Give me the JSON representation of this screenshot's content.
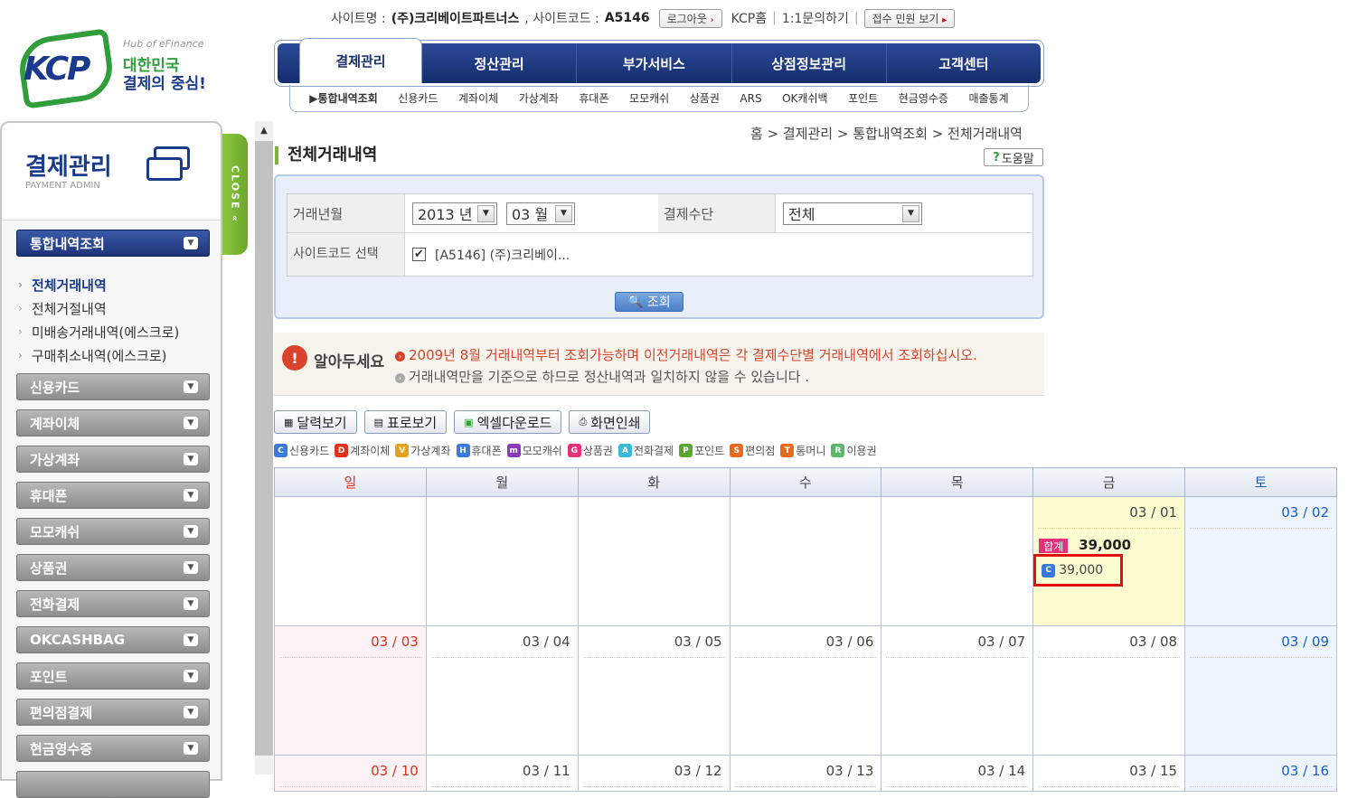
{
  "topbar": {
    "site_label": "사이트명 :",
    "site_name": "(주)크리베이트파트너스",
    "code_label": ", 사이트코드 :",
    "site_code": "A5146",
    "logout": "로그아웃",
    "kcp_home": "KCP홈",
    "inquiry": "1:1문의하기",
    "complaint": "접수 민원 보기"
  },
  "logo": {
    "brand": "KCP",
    "hub": "Hub of eFinance",
    "slogan1": "대한민국",
    "slogan2": "결제의 중심!"
  },
  "main_nav": [
    "결제관리",
    "정산관리",
    "부가서비스",
    "상점정보관리",
    "고객센터"
  ],
  "sub_nav": [
    "통합내역조회",
    "신용카드",
    "계좌이체",
    "가상계좌",
    "휴대폰",
    "모모캐쉬",
    "상품권",
    "ARS",
    "OK캐쉬백",
    "포인트",
    "현금영수증",
    "매출통계"
  ],
  "sidebar": {
    "title": "결제관리",
    "subtitle": "PAYMENT ADMIN",
    "close": "CLOSE",
    "active_menu": "통합내역조회",
    "sub_items": [
      "전체거래내역",
      "전체거절내역",
      "미배송거래내역(에스크로)",
      "구매취소내역(에스크로)"
    ],
    "menus": [
      "신용카드",
      "계좌이체",
      "가상계좌",
      "휴대폰",
      "모모캐쉬",
      "상품권",
      "전화결제",
      "OKCASHBAG",
      "포인트",
      "편의점결제",
      "현금영수증"
    ]
  },
  "breadcrumb": "홈 > 결제관리 > 통합내역조회 > 전체거래내역",
  "page_title": "전체거래내역",
  "help": "도움말",
  "search": {
    "month_label": "거래년월",
    "year": "2013 년",
    "month": "03 월",
    "method_label": "결제수단",
    "method": "전체",
    "site_label": "사이트코드 선택",
    "site_value": "[A5146] (주)크리베이...",
    "button": "조회"
  },
  "notice": {
    "label": "알아두세요",
    "line1": "2009년 8월 거래내역부터 조회가능하며 이전거래내역은 각 결제수단별 거래내역에서 조회하십시오.",
    "line2": "거래내역만을 기준으로 하므로 정산내역과 일치하지 않을 수 있습니다 ."
  },
  "actions": [
    "달력보기",
    "표로보기",
    "엑셀다운로드",
    "화면인쇄"
  ],
  "legend": [
    {
      "code": "C",
      "label": "신용카드",
      "color": "#3a7ad8"
    },
    {
      "code": "D",
      "label": "계좌이체",
      "color": "#e0301e"
    },
    {
      "code": "V",
      "label": "가상계좌",
      "color": "#e8a020"
    },
    {
      "code": "H",
      "label": "휴대폰",
      "color": "#3a7ad8"
    },
    {
      "code": "m",
      "label": "모모캐쉬",
      "color": "#8a3ab8"
    },
    {
      "code": "G",
      "label": "상품권",
      "color": "#e8307a"
    },
    {
      "code": "A",
      "label": "전화결제",
      "color": "#3ab8d8"
    },
    {
      "code": "P",
      "label": "포인트",
      "color": "#5aa830"
    },
    {
      "code": "S",
      "label": "편의점",
      "color": "#e86a20"
    },
    {
      "code": "T",
      "label": "통머니",
      "color": "#e86a20"
    },
    {
      "code": "R",
      "label": "이용권",
      "color": "#5ab868"
    }
  ],
  "calendar": {
    "weekdays": [
      "일",
      "월",
      "화",
      "수",
      "목",
      "금",
      "토"
    ],
    "weeks": [
      [
        "",
        "",
        "",
        "",
        "",
        "03 / 01",
        "03 / 02"
      ],
      [
        "03 / 03",
        "03 / 04",
        "03 / 05",
        "03 / 06",
        "03 / 07",
        "03 / 08",
        "03 / 09"
      ],
      [
        "03 / 10",
        "03 / 11",
        "03 / 12",
        "03 / 13",
        "03 / 14",
        "03 / 15",
        "03 / 16"
      ]
    ],
    "highlight": {
      "total_label": "합계",
      "total": "39,000",
      "entry_code": "C",
      "entry_amount": "39,000"
    }
  }
}
